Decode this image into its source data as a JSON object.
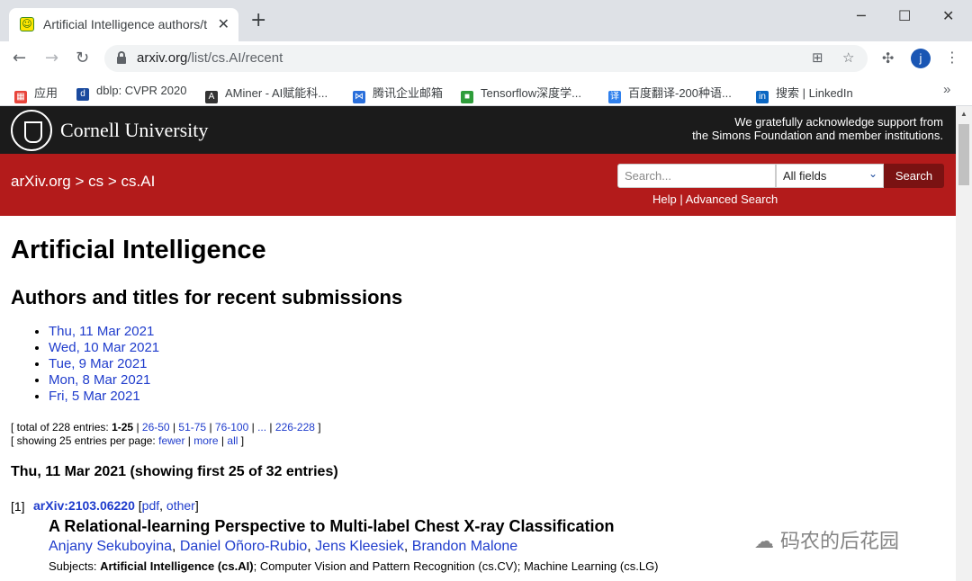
{
  "browser": {
    "tab_title": "Artificial Intelligence authors/t",
    "tab_close": "✕",
    "new_tab": "+",
    "window_min": "─",
    "window_max": "☐",
    "window_close": "✕",
    "url_host": "arxiv.org",
    "url_path": "/list/cs.AI/recent",
    "avatar_letter": "j",
    "bookmarks": [
      {
        "label": "应用",
        "color": "#e8453c"
      },
      {
        "label": "dblp: CVPR 2020",
        "color": "#1a4a9e"
      },
      {
        "label": "AMiner - AI赋能科...",
        "color": "#333333"
      },
      {
        "label": "腾讯企业邮箱",
        "color": "#2a6fdb"
      },
      {
        "label": "Tensorflow深度学...",
        "color": "#2e9d3a"
      },
      {
        "label": "百度翻译-200种语...",
        "color": "#2f80ed"
      },
      {
        "label": "搜索 | LinkedIn",
        "color": "#0a66c2"
      }
    ],
    "bookmarks_more": "»"
  },
  "header": {
    "brand": "Cornell University",
    "support_line1": "We gratefully acknowledge support from",
    "support_line2": "the Simons Foundation and member institutions.",
    "breadcrumb": "arXiv.org > cs > cs.AI",
    "search_placeholder": "Search...",
    "field_select": "All fields",
    "search_button": "Search",
    "help": "Help",
    "separator": " | ",
    "advanced_search": "Advanced Search"
  },
  "main": {
    "title": "Artificial Intelligence",
    "subtitle": "Authors and titles for recent submissions",
    "dates": [
      "Thu, 11 Mar 2021",
      "Wed, 10 Mar 2021",
      "Tue, 9 Mar 2021",
      "Mon, 8 Mar 2021",
      "Fri, 5 Mar 2021"
    ],
    "pager": {
      "total_prefix": "[ total of 228 entries: ",
      "current": "1-25",
      "pages": [
        "26-50",
        "51-75",
        "76-100",
        "...",
        "226-228"
      ],
      "showing_prefix": "[ showing 25 entries per page: ",
      "fewer": "fewer",
      "more": "more",
      "all": "all"
    },
    "day_heading": "Thu, 11 Mar 2021 (showing first 25 of 32 entries)",
    "entry": {
      "index": "[1]",
      "arxiv_id": "arXiv:2103.06220",
      "pdf": "pdf",
      "other": "other",
      "title": "A Relational-learning Perspective to Multi-label Chest X-ray Classification",
      "authors": [
        "Anjany Sekuboyina",
        "Daniel Oñoro-Rubio",
        "Jens Kleesiek",
        "Brandon Malone"
      ],
      "subjects_label": "Subjects: ",
      "primary_subject": "Artificial Intelligence (cs.AI)",
      "other_subjects": "; Computer Vision and Pattern Recognition (cs.CV); Machine Learning (cs.LG)"
    }
  },
  "watermark": "码农的后花园"
}
